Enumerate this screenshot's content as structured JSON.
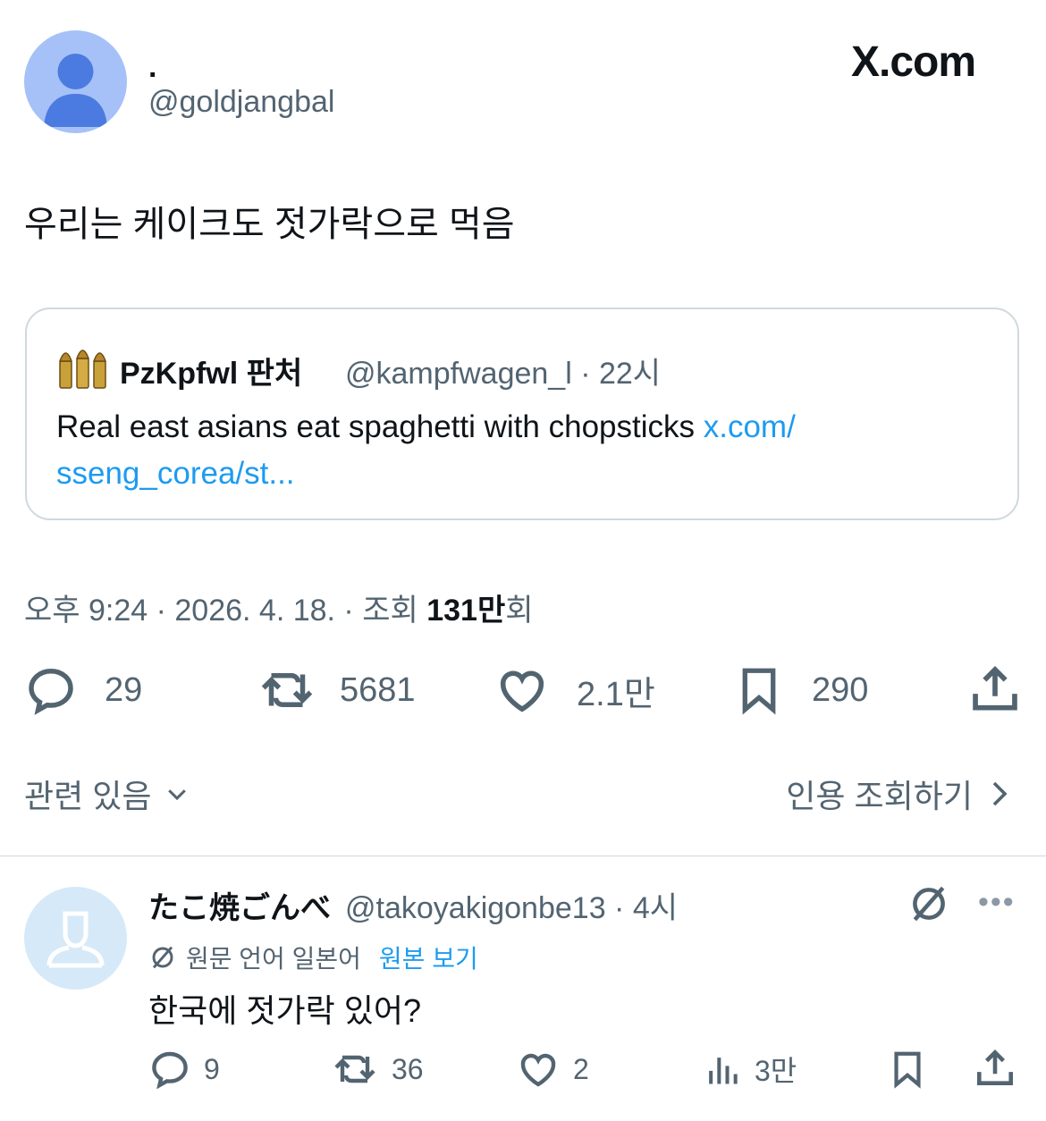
{
  "post": {
    "display_name": ".",
    "handle": "@goldjangbal",
    "brand": "X.com",
    "text": "우리는 케이크도 젓가락으로 먹음",
    "quote": {
      "display_name": "PzKpfwl 판처",
      "handle_time": "@kampfwagen_l · 22시",
      "text": "Real east asians eat spaghetti with chopsticks ",
      "link_part1": "x.com/",
      "link_part2": "sseng_corea/st..."
    },
    "meta_prefix": "오후 9:24 · 2026. 4. 18. · 조회 ",
    "meta_views": "131만",
    "meta_suffix": "회",
    "actions": {
      "replies": "29",
      "reposts": "5681",
      "likes": "2.1만",
      "bookmarks": "290"
    },
    "related_label": "관련 있음",
    "quotes_label": "인용 조회하기"
  },
  "reply": {
    "display_name": "たこ焼ごんべ",
    "handle_time": "@takoyakigonbe13 · 4시",
    "translate_note": "원문 언어 일본어",
    "show_original": "원본 보기",
    "text": "한국에 젓가락 있어?",
    "actions": {
      "replies": "9",
      "reposts": "36",
      "likes": "2",
      "views": "3만"
    }
  },
  "colors": {
    "link": "#1d9bf0",
    "secondary": "#536471",
    "border": "#cfd9de",
    "avatar_default": "#a6c1f7"
  }
}
